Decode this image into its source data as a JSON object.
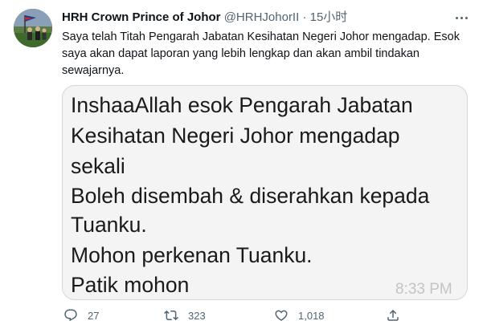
{
  "author": {
    "display_name": "HRH Crown Prince of Johor",
    "handle": "@HRHJohorII",
    "separator": "·",
    "time": "15小时"
  },
  "tweet": {
    "text": "Saya telah Titah Pengarah Jabatan Kesihatan Negeri Johor mengadap. Esok saya akan dapat laporan yang lebih lengkap dan akan ambil tindakan sewajarnya."
  },
  "media": {
    "lines": [
      "InshaaAllah esok Pengarah Jabatan",
      "Kesihatan Negeri Johor mengadap",
      "sekali",
      "Boleh disembah & diserahkan kepada",
      "Tuanku.",
      "Mohon perkenan Tuanku.",
      "Patik mohon"
    ],
    "time": "8:33 PM"
  },
  "actions": {
    "reply_count": "27",
    "retweet_count": "323",
    "like_count": "1,018",
    "icons": [
      "reply-icon",
      "retweet-icon",
      "like-icon",
      "share-icon"
    ]
  },
  "colors": {
    "text": "#0f1419",
    "secondary": "#536471",
    "border": "#cfd9de"
  }
}
